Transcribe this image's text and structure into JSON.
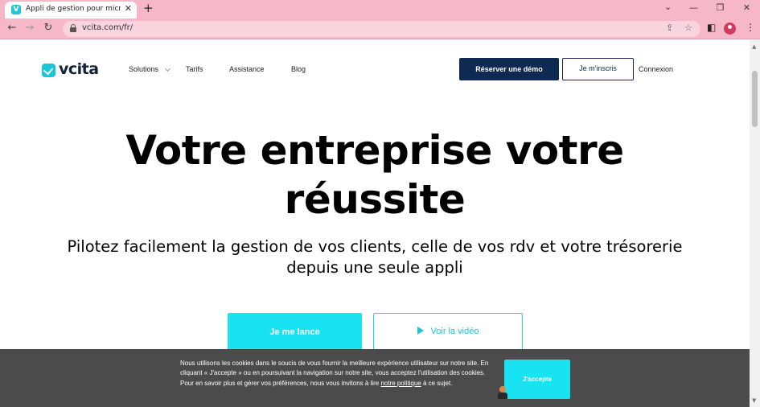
{
  "browser": {
    "tab_title": "Appli de gestion pour micro-entrepreneurs",
    "tab_favicon": "V",
    "tab_close": "✕",
    "new_tab": "+",
    "url": "vcita.com/fr/"
  },
  "site": {
    "logo_text": "vcita",
    "nav": {
      "solutions": "Solutions",
      "tarifs": "Tarifs",
      "assistance": "Assistance",
      "blog": "Blog"
    },
    "demo_button": "Réserver une démo",
    "signup_button": "Je m'inscris",
    "login_link": "Connexion"
  },
  "hero": {
    "title_line1": "Votre entreprise votre",
    "title_line2": "réussite",
    "subtitle_line1": "Pilotez facilement la gestion de vos clients, celle de vos rdv et votre trésorerie",
    "subtitle_line2": "depuis une seule appli",
    "start_button": "Je me lance",
    "video_button": "Voir la vidéo"
  },
  "cookie_banner": {
    "text_before": "Nous utilisons les cookies dans le soucis de vous fournir la meilleure expérience utilisateur sur notre site. En cliquant « J'accepte » ou en poursuivant la navigation sur notre site, vous acceptez l'utilisation des cookies. Pour en savoir plus et gérer vos préférences, nous vous invitons à lire ",
    "policy_link": "notre politique",
    "text_after": " à ce sujet.",
    "accept_button": "J'accepte"
  },
  "colors": {
    "browser_frame": "#f6b8c8",
    "brand_navy": "#0f2a52",
    "brand_cyan": "#19e3f2",
    "cookie_bg": "#4b4b4b"
  }
}
